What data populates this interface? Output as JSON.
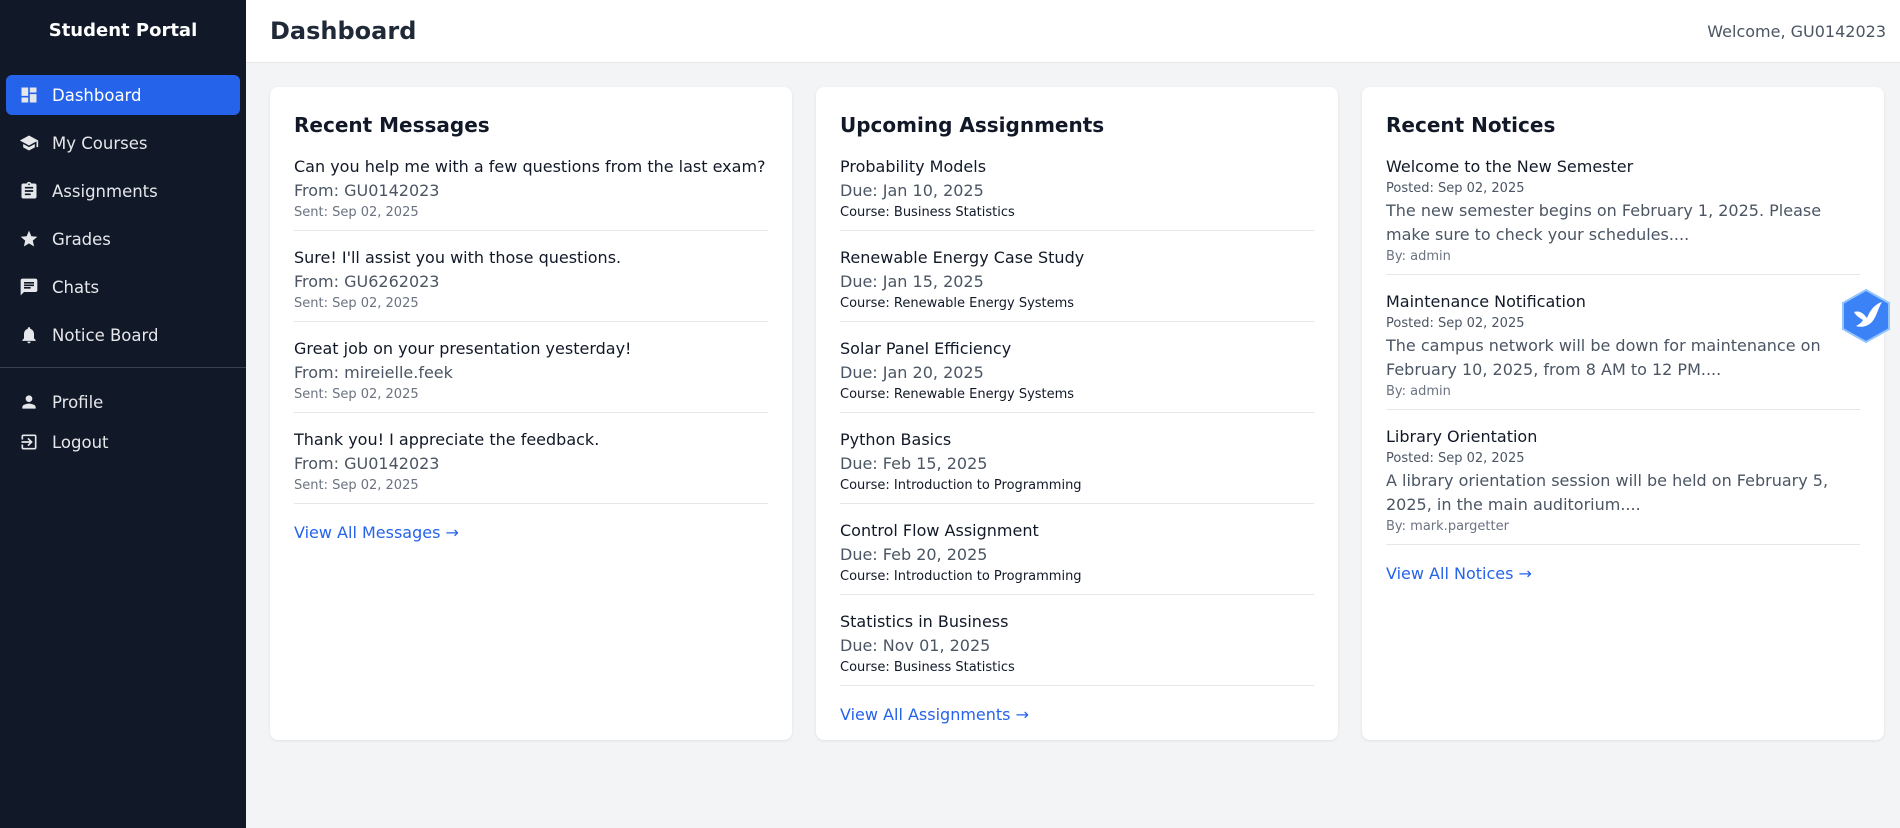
{
  "sidebar": {
    "brand": "Student Portal",
    "items": [
      {
        "label": "Dashboard",
        "icon": "dashboard-icon"
      },
      {
        "label": "My Courses",
        "icon": "graduation-cap-icon"
      },
      {
        "label": "Assignments",
        "icon": "clipboard-icon"
      },
      {
        "label": "Grades",
        "icon": "star-icon"
      },
      {
        "label": "Chats",
        "icon": "chat-icon"
      },
      {
        "label": "Notice Board",
        "icon": "bell-icon"
      }
    ],
    "bottom": [
      {
        "label": "Profile",
        "icon": "user-icon"
      },
      {
        "label": "Logout",
        "icon": "logout-icon"
      }
    ]
  },
  "header": {
    "title": "Dashboard",
    "welcome": "Welcome, GU0142023"
  },
  "messages": {
    "title": "Recent Messages",
    "items": [
      {
        "text": "Can you help me with a few questions from the last exam?",
        "from": "From: GU0142023",
        "sent": "Sent: Sep 02, 2025"
      },
      {
        "text": "Sure! I'll assist you with those questions.",
        "from": "From: GU6262023",
        "sent": "Sent: Sep 02, 2025"
      },
      {
        "text": "Great job on your presentation yesterday!",
        "from": "From: mireielle.feek",
        "sent": "Sent: Sep 02, 2025"
      },
      {
        "text": "Thank you! I appreciate the feedback.",
        "from": "From: GU0142023",
        "sent": "Sent: Sep 02, 2025"
      }
    ],
    "link": "View All Messages →"
  },
  "assignments": {
    "title": "Upcoming Assignments",
    "items": [
      {
        "name": "Probability Models",
        "due": "Due: Jan 10, 2025",
        "course": "Course: Business Statistics"
      },
      {
        "name": "Renewable Energy Case Study",
        "due": "Due: Jan 15, 2025",
        "course": "Course: Renewable Energy Systems"
      },
      {
        "name": "Solar Panel Efficiency",
        "due": "Due: Jan 20, 2025",
        "course": "Course: Renewable Energy Systems"
      },
      {
        "name": "Python Basics",
        "due": "Due: Feb 15, 2025",
        "course": "Course: Introduction to Programming"
      },
      {
        "name": "Control Flow Assignment",
        "due": "Due: Feb 20, 2025",
        "course": "Course: Introduction to Programming"
      },
      {
        "name": "Statistics in Business",
        "due": "Due: Nov 01, 2025",
        "course": "Course: Business Statistics"
      }
    ],
    "link": "View All Assignments →"
  },
  "notices": {
    "title": "Recent Notices",
    "items": [
      {
        "title": "Welcome to the New Semester",
        "posted": "Posted: Sep 02, 2025",
        "body": "The new semester begins on February 1, 2025. Please make sure to check your schedules....",
        "by": "By: admin"
      },
      {
        "title": "Maintenance Notification",
        "posted": "Posted: Sep 02, 2025",
        "body": "The campus network will be down for maintenance on February 10, 2025, from 8 AM to 12 PM....",
        "by": "By: admin"
      },
      {
        "title": "Library Orientation",
        "posted": "Posted: Sep 02, 2025",
        "body": "A library orientation session will be held on February 5, 2025, in the main auditorium....",
        "by": "By: mark.pargetter"
      }
    ],
    "link": "View All Notices →"
  },
  "floating_button": {
    "icon": "bird-icon"
  },
  "colors": {
    "sidebar_bg": "#111827",
    "accent": "#2563eb",
    "page_bg": "#f3f4f6"
  }
}
